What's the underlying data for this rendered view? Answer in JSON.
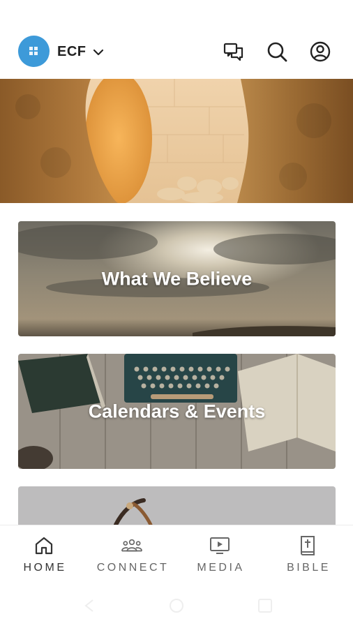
{
  "header": {
    "org_name": "ECF",
    "logo_color": "#3d9ad9",
    "icons": [
      "message-icon",
      "search-icon",
      "profile-icon"
    ]
  },
  "cards": [
    {
      "title": "What We Believe"
    },
    {
      "title": "Calendars & Events"
    },
    {
      "title": ""
    }
  ],
  "bottom_nav": {
    "items": [
      {
        "label": "HOME",
        "icon": "home-icon",
        "active": true
      },
      {
        "label": "CONNECT",
        "icon": "people-icon",
        "active": false
      },
      {
        "label": "MEDIA",
        "icon": "video-icon",
        "active": false
      },
      {
        "label": "BIBLE",
        "icon": "bible-icon",
        "active": false
      }
    ]
  },
  "colors": {
    "accent": "#3d9ad9",
    "nav_text": "#666666",
    "nav_active": "#333333"
  }
}
